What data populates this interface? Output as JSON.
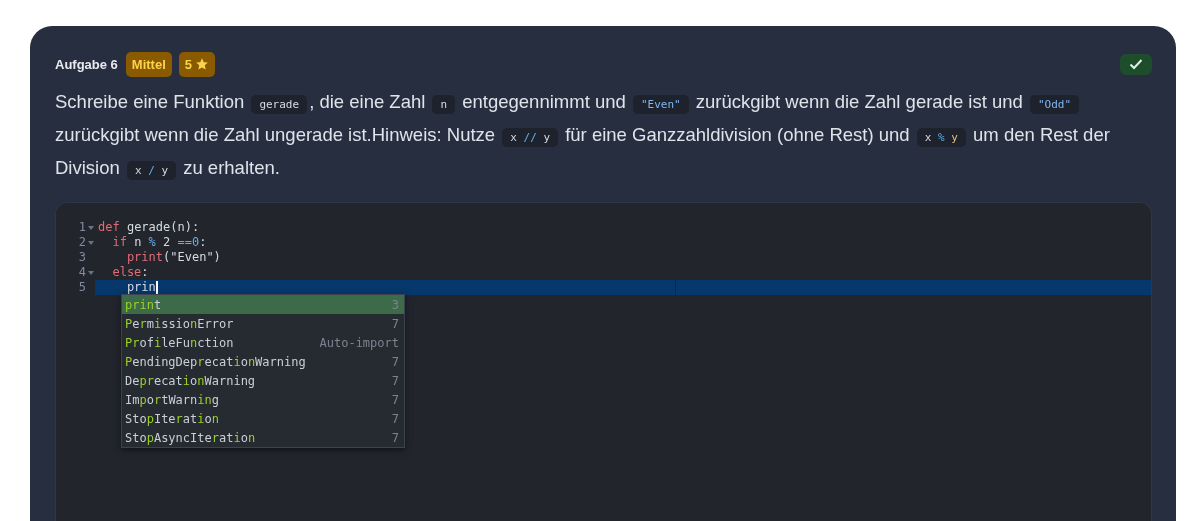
{
  "task": {
    "title": "Aufgabe 6",
    "difficulty": "Mittel",
    "points": "5",
    "solved": true
  },
  "description": [
    {
      "kind": "text",
      "text": "Schreibe eine Funktion "
    },
    {
      "kind": "code",
      "tokens": [
        {
          "kind": "plain",
          "text": "gerade"
        }
      ]
    },
    {
      "kind": "text",
      "text": ", die eine Zahl "
    },
    {
      "kind": "code",
      "tokens": [
        {
          "kind": "plain",
          "text": "n"
        }
      ]
    },
    {
      "kind": "text",
      "text": " entgegennimmt und "
    },
    {
      "kind": "code",
      "tokens": [
        {
          "kind": "string",
          "text": "\"Even\""
        }
      ]
    },
    {
      "kind": "text",
      "text": " zurückgibt wenn die Zahl gerade ist und "
    },
    {
      "kind": "code",
      "tokens": [
        {
          "kind": "string",
          "text": "\"Odd\""
        }
      ]
    },
    {
      "kind": "text",
      "text": " zurückgibt wenn die Zahl ungerade ist.Hinweis: Nutze "
    },
    {
      "kind": "code",
      "tokens": [
        {
          "kind": "plain",
          "text": "x "
        },
        {
          "kind": "operator",
          "text": "//"
        },
        {
          "kind": "plain",
          "text": " y"
        }
      ]
    },
    {
      "kind": "text",
      "text": " für eine Ganzzahldivision (ohne Rest) und "
    },
    {
      "kind": "code",
      "tokens": [
        {
          "kind": "plain",
          "text": "x "
        },
        {
          "kind": "operator",
          "text": "%"
        },
        {
          "kind": "name",
          "text": " y"
        }
      ]
    },
    {
      "kind": "text",
      "text": " um den Rest der Division "
    },
    {
      "kind": "code",
      "tokens": [
        {
          "kind": "plain",
          "text": "x "
        },
        {
          "kind": "operator",
          "text": "/"
        },
        {
          "kind": "plain",
          "text": " y"
        }
      ]
    },
    {
      "kind": "text",
      "text": " zu erhalten."
    }
  ],
  "editor": {
    "lines": [
      {
        "number": "1",
        "foldable": true,
        "active": false,
        "tokens": [
          {
            "kind": "keyword",
            "text": "def"
          },
          {
            "kind": "plain",
            "text": " gerade(n):"
          }
        ]
      },
      {
        "number": "2",
        "foldable": true,
        "active": false,
        "tokens": [
          {
            "kind": "keyword",
            "text": "  if"
          },
          {
            "kind": "plain",
            "text": " n "
          },
          {
            "kind": "operator",
            "text": "%"
          },
          {
            "kind": "plain",
            "text": " 2 "
          },
          {
            "kind": "operator",
            "text": "==0"
          },
          {
            "kind": "plain",
            "text": ":"
          }
        ]
      },
      {
        "number": "3",
        "foldable": false,
        "active": false,
        "tokens": [
          {
            "kind": "keyword",
            "text": "    print"
          },
          {
            "kind": "plain",
            "text": "(\"Even\")"
          }
        ]
      },
      {
        "number": "4",
        "foldable": true,
        "active": false,
        "tokens": [
          {
            "kind": "keyword",
            "text": "  else"
          },
          {
            "kind": "plain",
            "text": ":"
          }
        ]
      },
      {
        "number": "5",
        "foldable": false,
        "active": true,
        "tokens": [
          {
            "kind": "plain",
            "text": "    prin"
          }
        ]
      }
    ],
    "completions": [
      {
        "selected": true,
        "detail": "3",
        "parts": [
          {
            "text": "prin",
            "match": true
          },
          {
            "text": "t",
            "match": false
          }
        ]
      },
      {
        "selected": false,
        "detail": "7",
        "parts": [
          {
            "text": "P",
            "match": true
          },
          {
            "text": "e",
            "match": false
          },
          {
            "text": "r",
            "match": true
          },
          {
            "text": "m",
            "match": false
          },
          {
            "text": "i",
            "match": true
          },
          {
            "text": "ssio",
            "match": false
          },
          {
            "text": "n",
            "match": true
          },
          {
            "text": "Error",
            "match": false
          }
        ]
      },
      {
        "selected": false,
        "detail": "Auto-import",
        "parts": [
          {
            "text": "Pr",
            "match": true
          },
          {
            "text": "of",
            "match": false
          },
          {
            "text": "i",
            "match": true
          },
          {
            "text": "leFu",
            "match": false
          },
          {
            "text": "n",
            "match": true
          },
          {
            "text": "ction",
            "match": false
          }
        ]
      },
      {
        "selected": false,
        "detail": "7",
        "parts": [
          {
            "text": "P",
            "match": true
          },
          {
            "text": "endingDep",
            "match": false
          },
          {
            "text": "r",
            "match": true
          },
          {
            "text": "ecat",
            "match": false
          },
          {
            "text": "i",
            "match": true
          },
          {
            "text": "o",
            "match": false
          },
          {
            "text": "n",
            "match": true
          },
          {
            "text": "Warning",
            "match": false
          }
        ]
      },
      {
        "selected": false,
        "detail": "7",
        "parts": [
          {
            "text": "De",
            "match": false
          },
          {
            "text": "pr",
            "match": true
          },
          {
            "text": "ecat",
            "match": false
          },
          {
            "text": "i",
            "match": true
          },
          {
            "text": "o",
            "match": false
          },
          {
            "text": "n",
            "match": true
          },
          {
            "text": "Warning",
            "match": false
          }
        ]
      },
      {
        "selected": false,
        "detail": "7",
        "parts": [
          {
            "text": "Im",
            "match": false
          },
          {
            "text": "p",
            "match": true
          },
          {
            "text": "o",
            "match": false
          },
          {
            "text": "r",
            "match": true
          },
          {
            "text": "tWarn",
            "match": false
          },
          {
            "text": "in",
            "match": true
          },
          {
            "text": "g",
            "match": false
          }
        ]
      },
      {
        "selected": false,
        "detail": "7",
        "parts": [
          {
            "text": "Sto",
            "match": false
          },
          {
            "text": "p",
            "match": true
          },
          {
            "text": "Ite",
            "match": false
          },
          {
            "text": "r",
            "match": true
          },
          {
            "text": "at",
            "match": false
          },
          {
            "text": "i",
            "match": true
          },
          {
            "text": "o",
            "match": false
          },
          {
            "text": "n",
            "match": true
          }
        ]
      },
      {
        "selected": false,
        "detail": "7",
        "parts": [
          {
            "text": "Sto",
            "match": false
          },
          {
            "text": "p",
            "match": true
          },
          {
            "text": "AsyncIte",
            "match": false
          },
          {
            "text": "r",
            "match": true
          },
          {
            "text": "at",
            "match": false
          },
          {
            "text": "i",
            "match": true
          },
          {
            "text": "o",
            "match": false
          },
          {
            "text": "n",
            "match": true
          }
        ]
      }
    ]
  }
}
